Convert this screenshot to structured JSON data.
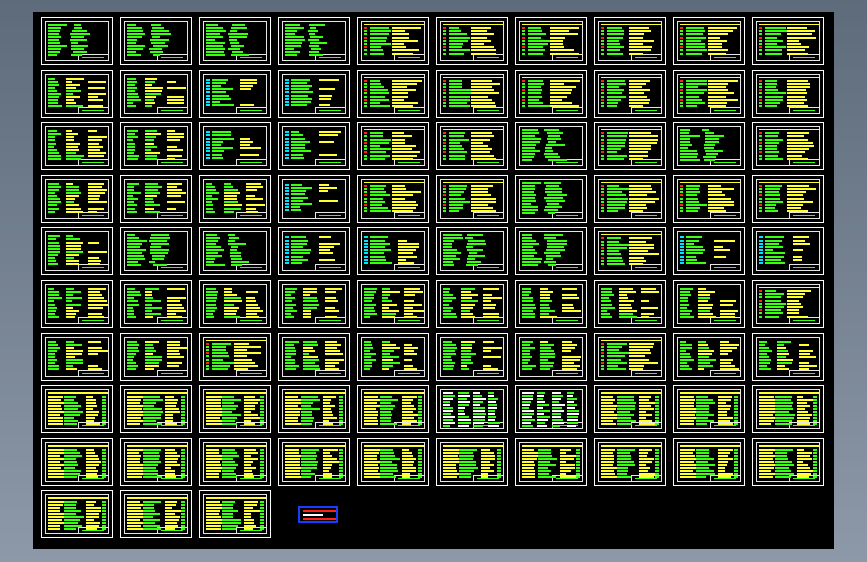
{
  "app": {
    "title": ""
  },
  "drawing": {
    "rows": 10,
    "cols": 10,
    "last_row_sheets": 3,
    "colors": {
      "background": "#000000",
      "text_green": "#39ff14",
      "text_yellow": "#ffff33",
      "text_cyan": "#00e5ff",
      "border": "#ffffff",
      "accent_red": "#ff2020",
      "legend_blue": "#1a3cff"
    },
    "sheet_style": [
      "green",
      "green",
      "green",
      "green",
      "yellow",
      "yellow",
      "yellow",
      "yellow",
      "yellow",
      "yellow",
      "mixed",
      "mixed",
      "cyan",
      "cyan",
      "yellow",
      "yellow",
      "yellow",
      "yellow",
      "yellow",
      "yellow",
      "mixed",
      "mixed",
      "cyan",
      "cyan",
      "yellow",
      "yellow",
      "green",
      "yellow",
      "green",
      "yellow",
      "mixed",
      "mixed",
      "mixed",
      "cyan",
      "yellow",
      "yellow",
      "green",
      "yellow",
      "yellow",
      "yellow",
      "mixed",
      "green",
      "green",
      "cyan",
      "cyan",
      "green",
      "green",
      "yellow",
      "cyan",
      "cyan",
      "mixed",
      "mixed",
      "mixed",
      "mixed",
      "mixed",
      "mixed",
      "mixed",
      "mixed",
      "mixed",
      "yellow",
      "mixed",
      "mixed",
      "yellow",
      "mixed",
      "mixed",
      "mixed",
      "mixed",
      "yellow",
      "mixed",
      "mixed",
      "table",
      "table",
      "table",
      "table",
      "table",
      "dense",
      "dense",
      "table",
      "table",
      "table",
      "table",
      "table",
      "table",
      "table",
      "table",
      "table",
      "table",
      "table",
      "table",
      "table",
      "table",
      "table",
      "table"
    ]
  }
}
